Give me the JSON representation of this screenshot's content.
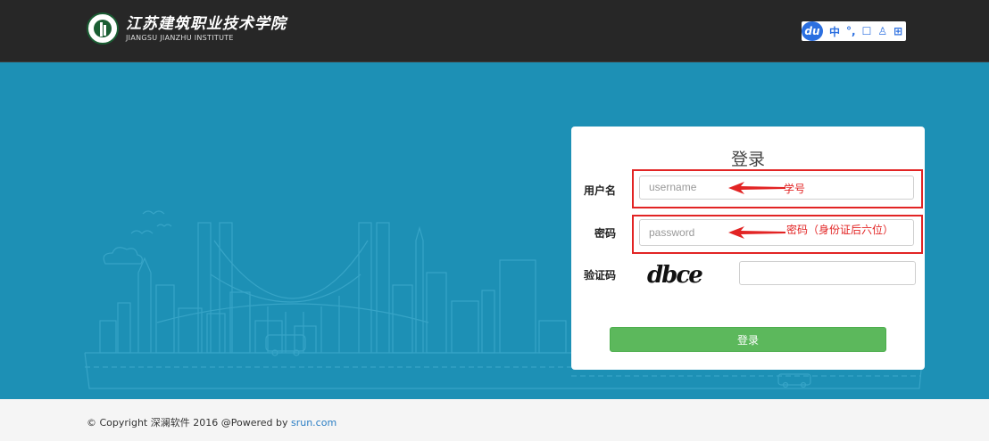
{
  "header": {
    "logo_cn": "江苏建筑职业技术学院",
    "logo_en": "JIANGSU JIANZHU INSTITUTE",
    "ime": {
      "brand": "du",
      "items": [
        "中",
        "°,",
        "☐",
        "♙",
        "⊞"
      ]
    }
  },
  "login": {
    "title": "登录",
    "username": {
      "label": "用户名",
      "placeholder": "username",
      "annotation": "学号"
    },
    "password": {
      "label": "密码",
      "placeholder": "password",
      "annotation": "密码（身份证后六位）"
    },
    "captcha": {
      "label": "验证码",
      "image_text": "dbce",
      "value": ""
    },
    "submit_label": "登录"
  },
  "footer": {
    "copyright": "© Copyright 深澜软件 2016 @Powered by ",
    "link": "srun.com"
  },
  "colors": {
    "accent": "#1d90b5",
    "submit": "#5cb85c",
    "annotation": "#e22424",
    "topbar": "#272727"
  }
}
